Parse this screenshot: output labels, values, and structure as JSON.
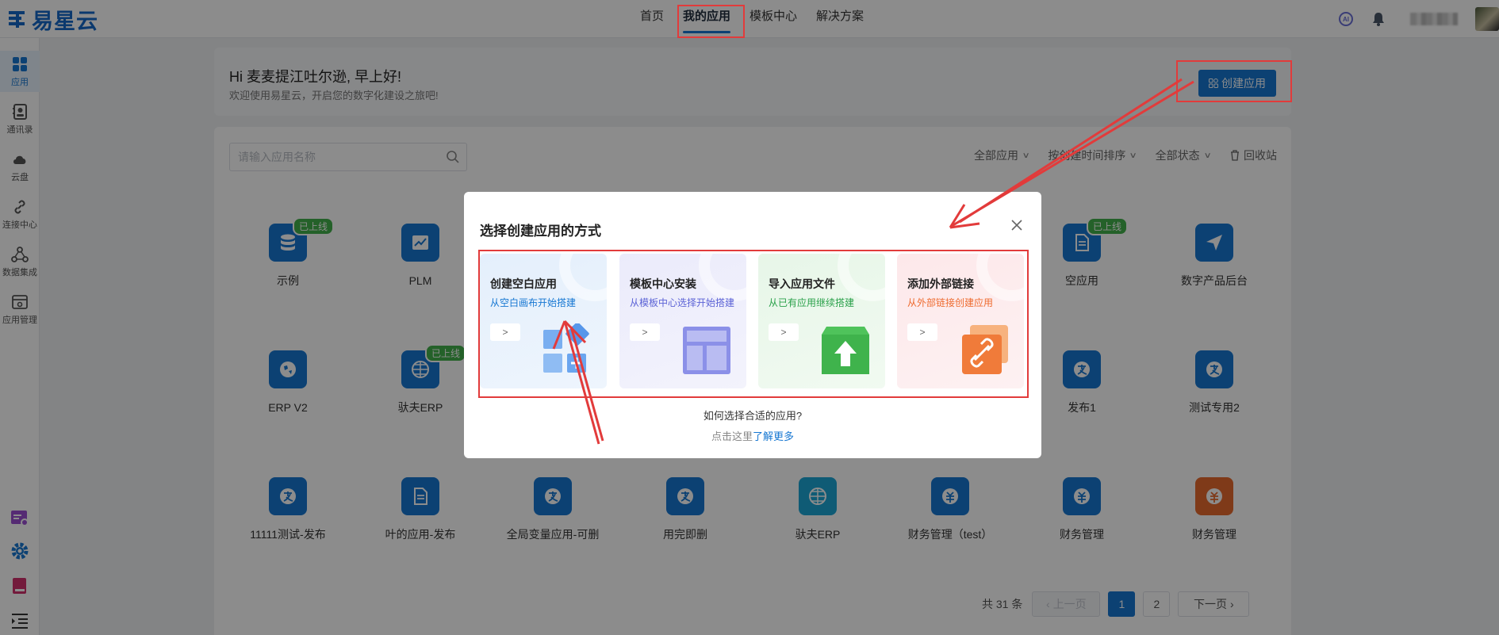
{
  "header": {
    "brand": "易星云",
    "nav": [
      {
        "label": "首页",
        "active": false
      },
      {
        "label": "我的应用",
        "active": true
      },
      {
        "label": "模板中心",
        "active": false
      },
      {
        "label": "解决方案",
        "active": false
      }
    ],
    "ai_label": "AI"
  },
  "sidebar": {
    "items": [
      {
        "label": "应用",
        "icon": "grid-icon",
        "active": true
      },
      {
        "label": "通讯录",
        "icon": "contacts-icon",
        "active": false
      },
      {
        "label": "云盘",
        "icon": "cloud-icon",
        "active": false
      },
      {
        "label": "连接中心",
        "icon": "link-icon",
        "active": false
      },
      {
        "label": "数据集成",
        "icon": "data-integration-icon",
        "active": false
      },
      {
        "label": "应用管理",
        "icon": "app-management-icon",
        "active": false
      }
    ]
  },
  "welcome": {
    "title": "Hi  麦麦提江吐尔逊, 早上好!",
    "subtitle": "欢迎使用易星云，开启您的数字化建设之旅吧!"
  },
  "create_button": {
    "label": "创建应用"
  },
  "search": {
    "placeholder": "请输入应用名称"
  },
  "filters": {
    "all_apps": "全部应用",
    "sort": "按创建时间排序",
    "status": "全部状态",
    "recycle": "回收站"
  },
  "apps": [
    {
      "name": "示例",
      "badge": "已上线",
      "icon": "database-icon"
    },
    {
      "name": "PLM",
      "badge": "",
      "icon": "chart-icon"
    },
    {
      "name": "空应用",
      "badge": "已上线",
      "icon": "document-icon"
    },
    {
      "name": "数字产品后台",
      "badge": "",
      "icon": "send-icon"
    },
    {
      "name": "ERP V2",
      "badge": "",
      "icon": "globe-icon"
    },
    {
      "name": "驮夫ERP",
      "badge": "已上线",
      "icon": "globe-icon"
    },
    {
      "name": "发布1",
      "badge": "",
      "icon": "alipay-icon"
    },
    {
      "name": "测试专用2",
      "badge": "",
      "icon": "alipay-icon"
    },
    {
      "name": "11111测试-发布",
      "badge": "",
      "icon": "alipay-icon"
    },
    {
      "name": "叶的应用-发布",
      "badge": "",
      "icon": "document-icon"
    },
    {
      "name": "全局变量应用-可删",
      "badge": "",
      "icon": "alipay-icon"
    },
    {
      "name": "用完即删",
      "badge": "",
      "icon": "alipay-icon"
    },
    {
      "name": "驮夫ERP",
      "badge": "",
      "icon": "globe-icon"
    },
    {
      "name": "财务管理（test）",
      "badge": "",
      "icon": "finance-icon"
    },
    {
      "name": "财务管理",
      "badge": "",
      "icon": "finance-icon"
    },
    {
      "name": "财务管理",
      "badge": "",
      "icon": "finance-icon"
    }
  ],
  "pagination": {
    "total": "共 31 条",
    "prev": "上一页",
    "pages": [
      "1",
      "2"
    ],
    "current": "1",
    "next": "下一页"
  },
  "modal": {
    "title": "选择创建应用的方式",
    "options": [
      {
        "title": "创建空白应用",
        "subtitle": "从空白画布开始搭建",
        "arrow": ">"
      },
      {
        "title": "模板中心安装",
        "subtitle": "从模板中心选择开始搭建",
        "arrow": ">"
      },
      {
        "title": "导入应用文件",
        "subtitle": "从已有应用继续搭建",
        "arrow": ">"
      },
      {
        "title": "添加外部链接",
        "subtitle": "从外部链接创建应用",
        "arrow": ">"
      }
    ],
    "help_question": "如何选择合适的应用?",
    "help_prefix": "点击这里",
    "help_link": "了解更多"
  },
  "colors": {
    "primary": "#1677d2",
    "badge_green": "#43b14b",
    "annotation_red": "#e23b3b"
  }
}
